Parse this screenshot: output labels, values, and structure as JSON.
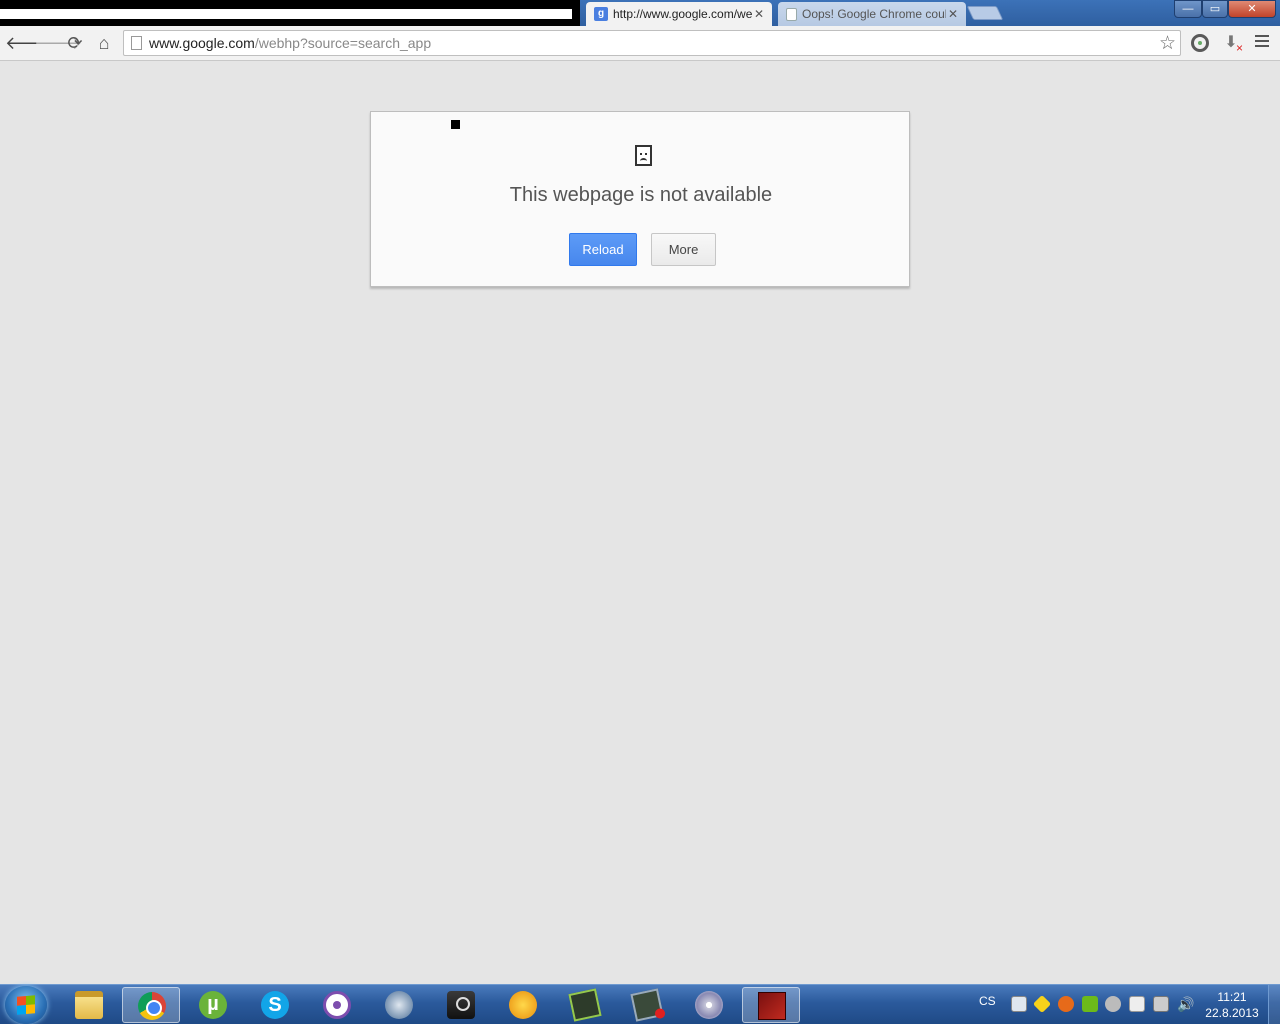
{
  "browser": {
    "tabs": [
      {
        "title": "http://www.google.com/webhp?source=search_app",
        "active": true,
        "favicon": "google-favicon"
      },
      {
        "title": "Oops! Google Chrome could not connect",
        "active": false,
        "favicon": "page-favicon"
      }
    ],
    "window_controls": {
      "minimize": "—",
      "maximize": "▭",
      "close": "✕"
    },
    "toolbar": {
      "back": "🡐",
      "forward": "🡒",
      "reload": "⟳",
      "home": "⌂",
      "url_host": "www.google.com",
      "url_rest": "/webhp?source=search_app",
      "star": "☆"
    }
  },
  "error_page": {
    "title": "This webpage is not available",
    "reload_label": "Reload",
    "more_label": "More",
    "accent_color": "#4787ed"
  },
  "taskbar": {
    "apps": [
      "windows-explorer",
      "google-chrome",
      "utorrent",
      "skype",
      "viber",
      "teamspeak",
      "steam",
      "fl-studio",
      "app-1",
      "app-2",
      "disc-burner",
      "dota-2"
    ],
    "utorrent_glyph": "µ",
    "skype_glyph": "S",
    "language": "CS",
    "volume_glyph": "🔊",
    "time": "11:21",
    "date": "22.8.2013"
  }
}
